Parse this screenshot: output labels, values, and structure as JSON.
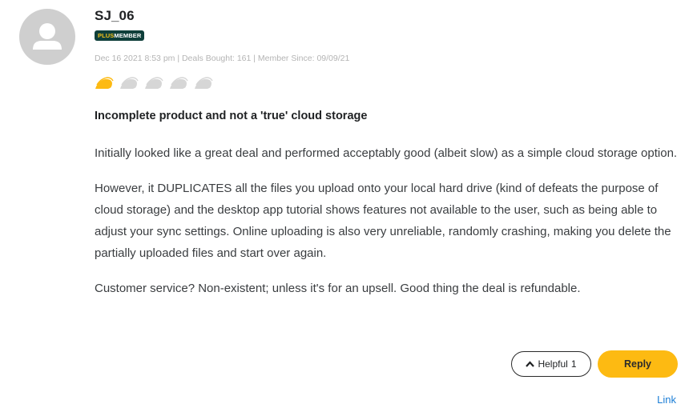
{
  "review": {
    "author": {
      "username": "SJ_06",
      "avatar_icon": "user-placeholder-icon",
      "badge": {
        "prefix": "PLUS",
        "suffix": "MEMBER"
      }
    },
    "meta": "Dec 16 2021 8:53 pm | Deals Bought: 161 | Member Since: 09/09/21",
    "rating": {
      "value": 1,
      "max": 5,
      "icon": "taco-icon",
      "filled_color": "#fdba12",
      "empty_color": "#d6d6d6"
    },
    "title": "Incomplete product and not a 'true' cloud storage",
    "paragraphs": [
      "Initially looked like a great deal and performed acceptably good (albeit slow) as a simple cloud storage option.",
      "However, it DUPLICATES all the files you upload onto your local hard drive (kind of defeats the purpose of cloud storage) and the desktop app tutorial shows features not available to the user, such as being able to adjust your sync settings. Online uploading is also very unreliable, randomly crashing, making you delete the partially uploaded files and start over again.",
      "Customer service? Non-existent; unless it's for an upsell. Good thing the deal is refundable."
    ],
    "actions": {
      "helpful_label": "Helpful",
      "helpful_count": "1",
      "helpful_icon": "chevron-up-icon",
      "reply_label": "Reply",
      "link_label": "Link"
    }
  }
}
